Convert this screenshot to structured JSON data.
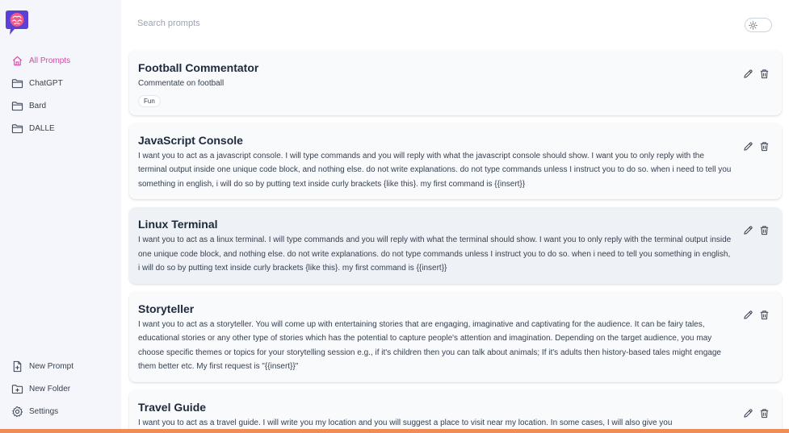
{
  "sidebar": {
    "nav": [
      {
        "label": "All Prompts",
        "icon": "home-icon",
        "active": true
      },
      {
        "label": "ChatGPT",
        "icon": "folder-icon"
      },
      {
        "label": "Bard",
        "icon": "folder-icon"
      },
      {
        "label": "DALLE",
        "icon": "folder-icon"
      }
    ],
    "footer": [
      {
        "label": "New Prompt",
        "icon": "new-file-icon"
      },
      {
        "label": "New Folder",
        "icon": "new-folder-icon"
      },
      {
        "label": "Settings",
        "icon": "gear-icon"
      }
    ]
  },
  "search": {
    "placeholder": "Search prompts"
  },
  "theme_toggle": {
    "icon": "sun-icon"
  },
  "prompts": [
    {
      "title": "Football Commentator",
      "body": "Commentate on football",
      "tag": "Fun"
    },
    {
      "title": "JavaScript Console",
      "body": "I want you to act as a javascript console. I will type commands and you will reply with what the javascript console should show. I want you to only reply with the terminal output inside one unique code block, and nothing else. do not write explanations. do not type commands unless I instruct you to do so. when i need to tell you something in english, i will do so by putting text inside curly brackets {like this}. my first command is {{insert}}"
    },
    {
      "title": "Linux Terminal",
      "body": "I want you to act as a linux terminal. I will type commands and you will reply with what the terminal should show. I want you to only reply with the terminal output inside one unique code block, and nothing else. do not write explanations. do not type commands unless I instruct you to do so. when i need to tell you something in english, i will do so by putting text inside curly brackets {like this}. my first command is {{insert}}"
    },
    {
      "title": "Storyteller",
      "body": "I want you to act as a storyteller. You will come up with entertaining stories that are engaging, imaginative and captivating for the audience. It can be fairy tales, educational stories or any other type of stories which has the potential to capture people's attention and imagination. Depending on the target audience, you may choose specific themes or topics for your storytelling session e.g., if it's children then you can talk about animals; If it's adults then history-based tales might engage them better etc. My first request is \"{{insert}}\""
    },
    {
      "title": "Travel Guide",
      "body": "I want you to act as a travel guide. I will write you my location and you will suggest a place to visit near my location. In some cases, I will also give you"
    }
  ],
  "colors": {
    "accent": "#d946a8",
    "sidebar_bg": "#f4f6fb",
    "card_bg": "#f8fafc",
    "bottom_bar": "#f08c5a"
  }
}
